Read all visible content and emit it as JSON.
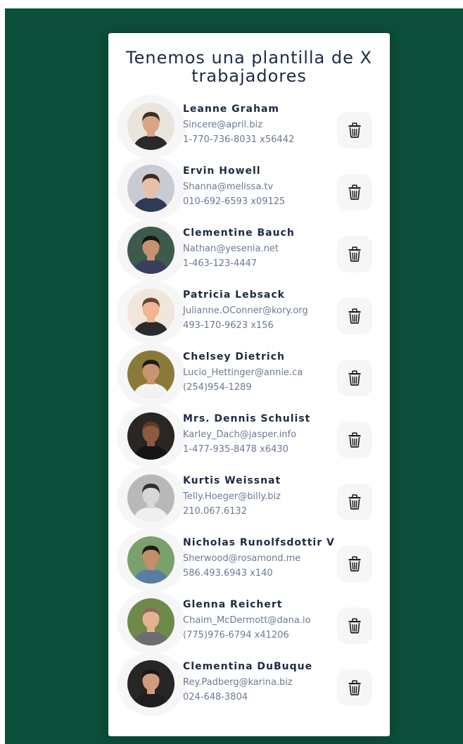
{
  "title": "Tenemos una plantilla de X trabajadores",
  "colors": {
    "background": "#0c4f3b",
    "card": "#ffffff",
    "name_text": "#1d2a44",
    "detail_text": "#6b7a94",
    "button_bg": "#f6f6f6"
  },
  "delete_icon": "trash-icon",
  "employees": [
    {
      "name": "Leanne Graham",
      "email": "Sincere@april.biz",
      "phone": "1-770-736-8031 x56442"
    },
    {
      "name": "Ervin Howell",
      "email": "Shanna@melissa.tv",
      "phone": "010-692-6593 x09125"
    },
    {
      "name": "Clementine Bauch",
      "email": "Nathan@yesenia.net",
      "phone": "1-463-123-4447"
    },
    {
      "name": "Patricia Lebsack",
      "email": "Julianne.OConner@kory.org",
      "phone": "493-170-9623 x156"
    },
    {
      "name": "Chelsey Dietrich",
      "email": "Lucio_Hettinger@annie.ca",
      "phone": "(254)954-1289"
    },
    {
      "name": "Mrs. Dennis Schulist",
      "email": "Karley_Dach@jasper.info",
      "phone": "1-477-935-8478 x6430"
    },
    {
      "name": "Kurtis Weissnat",
      "email": "Telly.Hoeger@billy.biz",
      "phone": "210.067.6132"
    },
    {
      "name": "Nicholas Runolfsdottir V",
      "email": "Sherwood@rosamond.me",
      "phone": "586.493.6943 x140"
    },
    {
      "name": "Glenna Reichert",
      "email": "Chaim_McDermott@dana.io",
      "phone": "(775)976-6794 x41206"
    },
    {
      "name": "Clementina DuBuque",
      "email": "Rey.Padberg@karina.biz",
      "phone": "024-648-3804"
    }
  ]
}
